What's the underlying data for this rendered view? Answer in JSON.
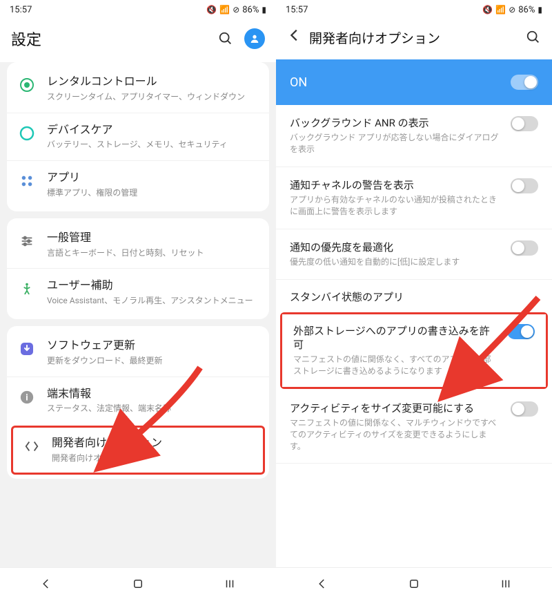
{
  "statusbar": {
    "time": "15:57",
    "battery": "86%"
  },
  "left": {
    "header": {
      "title": "設定"
    },
    "groups": [
      {
        "items": [
          {
            "icon": "parental",
            "title": "レンタルコントロール",
            "sub": "スクリーンタイム、アプリタイマー、ウィンドダウン"
          },
          {
            "icon": "devicecare",
            "title": "デバイスケア",
            "sub": "バッテリー、ストレージ、メモリ、セキュリティ"
          },
          {
            "icon": "apps",
            "title": "アプリ",
            "sub": "標準アプリ、権限の管理"
          }
        ]
      },
      {
        "items": [
          {
            "icon": "general",
            "title": "一般管理",
            "sub": "言語とキーボード、日付と時刻、リセット"
          },
          {
            "icon": "accessibility",
            "title": "ユーザー補助",
            "sub": "Voice Assistant、モノラル再生、アシスタントメニュー"
          }
        ]
      },
      {
        "items": [
          {
            "icon": "update",
            "title": "ソフトウェア更新",
            "sub": "更新をダウンロード、最終更新"
          },
          {
            "icon": "about",
            "title": "端末情報",
            "sub": "ステータス、法定情報、端末名称"
          },
          {
            "icon": "dev",
            "title": "開発者向けオプション",
            "sub": "開発者向けオプション",
            "highlight": true
          }
        ]
      }
    ]
  },
  "right": {
    "header": {
      "title": "開発者向けオプション"
    },
    "on_label": "ON",
    "items": [
      {
        "title": "バックグラウンド ANR の表示",
        "sub": "バックグラウンド アプリが応答しない場合にダイアログを表示",
        "toggle": "off"
      },
      {
        "title": "通知チャネルの警告を表示",
        "sub": "アプリから有効なチャネルのない通知が投稿されたときに画面上に警告を表示します",
        "toggle": "off"
      },
      {
        "title": "通知の優先度を最適化",
        "sub": "優先度の低い通知を自動的に[低]に設定します",
        "toggle": "off"
      }
    ],
    "section": "スタンバイ状態のアプリ",
    "highlight_item": {
      "title": "外部ストレージへのアプリの書き込みを許可",
      "sub": "マニフェストの値に関係なく、すべてのアプリを外部ストレージに書き込めるようになります",
      "toggle": "on"
    },
    "last_item": {
      "title": "アクティビティをサイズ変更可能にする",
      "sub": "マニフェストの値に関係なく、マルチウィンドウですべてのアクティビティのサイズを変更できるようにします。",
      "toggle": "off"
    }
  }
}
